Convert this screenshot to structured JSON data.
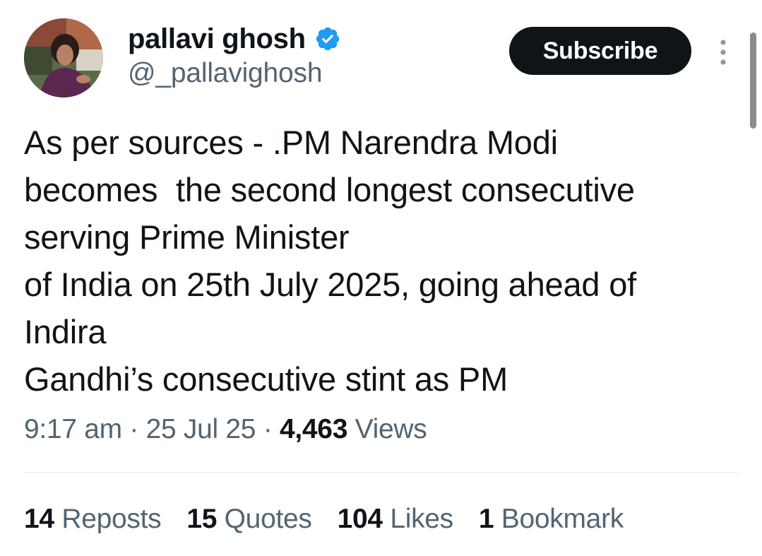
{
  "author": {
    "display_name": "pallavi ghosh",
    "handle": "@_pallavighosh",
    "verified_icon": "verified-badge-icon"
  },
  "actions": {
    "subscribe_label": "Subscribe",
    "more_icon": "more-vertical-icon"
  },
  "tweet": {
    "lines": [
      "As per sources - .PM Narendra Modi",
      "becomes  the second longest consecutive",
      "serving Prime Minister",
      "of India on 25th July 2025, going ahead of",
      "Indira",
      "Gandhi’s consecutive stint as PM"
    ]
  },
  "meta": {
    "time": "9:17 am",
    "separator": "·",
    "date": "25 Jul 25",
    "views_count": "4,463",
    "views_label": "Views"
  },
  "stats": [
    {
      "count": "14",
      "label": "Reposts"
    },
    {
      "count": "15",
      "label": "Quotes"
    },
    {
      "count": "104",
      "label": "Likes"
    },
    {
      "count": "1",
      "label": "Bookmark"
    }
  ],
  "colors": {
    "text_primary": "#0f1419",
    "text_secondary": "#536471",
    "verified_blue": "#1d9bf0",
    "button_bg": "#0f1419"
  }
}
